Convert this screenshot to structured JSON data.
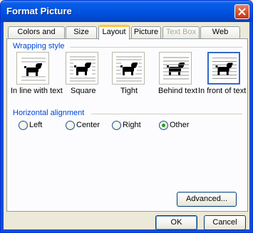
{
  "window": {
    "title": "Format Picture"
  },
  "tabs": [
    {
      "label": "Colors and Lines",
      "state": "normal"
    },
    {
      "label": "Size",
      "state": "normal"
    },
    {
      "label": "Layout",
      "state": "active"
    },
    {
      "label": "Picture",
      "state": "normal"
    },
    {
      "label": "Text Box",
      "state": "disabled"
    },
    {
      "label": "Web",
      "state": "normal"
    }
  ],
  "wrapping": {
    "label": "Wrapping style",
    "options": [
      {
        "label": "In line with text",
        "icon": "inline-dog-icon"
      },
      {
        "label": "Square",
        "icon": "square-dog-icon"
      },
      {
        "label": "Tight",
        "icon": "tight-dog-icon"
      },
      {
        "label": "Behind text",
        "icon": "behind-text-dog-icon"
      },
      {
        "label": "In front of text",
        "icon": "in-front-dog-icon"
      }
    ],
    "selected": "In front of text"
  },
  "alignment": {
    "label": "Horizontal alignment",
    "options": [
      {
        "label": "Left"
      },
      {
        "label": "Center"
      },
      {
        "label": "Right"
      },
      {
        "label": "Other"
      }
    ],
    "selected": "Other"
  },
  "buttons": {
    "advanced": "Advanced...",
    "ok": "OK",
    "cancel": "Cancel"
  },
  "colors": {
    "accent": "#0054e3",
    "group_label": "#0046d5",
    "selected_border": "#316ac5"
  }
}
